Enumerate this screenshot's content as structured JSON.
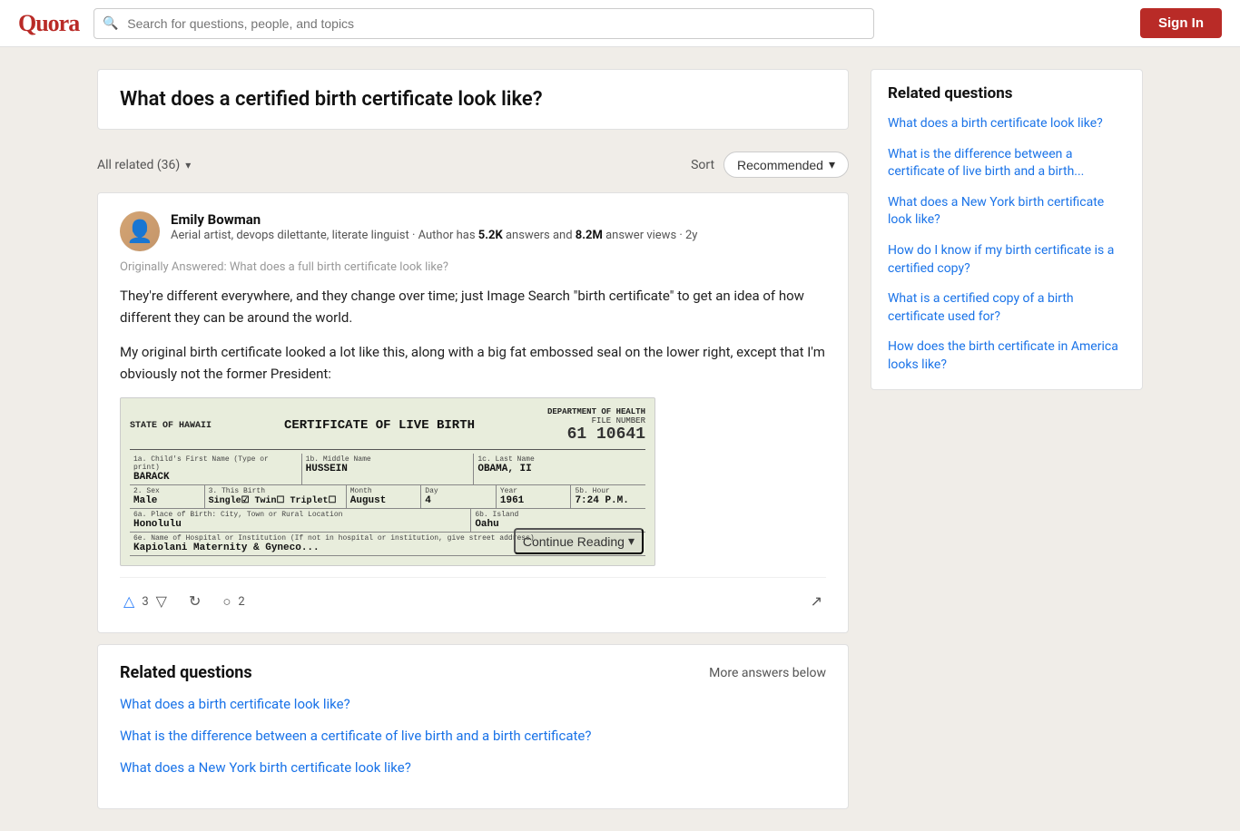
{
  "header": {
    "logo": "Quora",
    "search_placeholder": "Search for questions, people, and topics",
    "sign_in_label": "Sign In"
  },
  "question": {
    "title": "What does a certified birth certificate look like?"
  },
  "filter": {
    "all_related_label": "All related (36)",
    "sort_label": "Sort",
    "recommended_label": "Recommended"
  },
  "answer": {
    "author_name": "Emily Bowman",
    "author_bio": "Aerial artist, devops dilettante, literate linguist · Author has",
    "author_answers": "5.2K",
    "author_bio_mid": "answers and",
    "author_views": "8.2M",
    "author_bio_end": "answer views · 2y",
    "originally_answered": "Originally Answered: What does a full birth certificate look like?",
    "text1": "They're different everywhere, and they change over time; just Image Search \"birth certificate\" to get an idea of how different they can be around the world.",
    "text2": "My original birth certificate looked a lot like this, along with a big fat embossed seal on the lower right, except that I'm obviously not the former President:",
    "continue_reading": "Continue Reading",
    "upvotes": "3",
    "comments": "2"
  },
  "cert": {
    "state": "STATE OF HAWAII",
    "title": "CERTIFICATE OF LIVE BIRTH",
    "dept": "DEPARTMENT OF HEALTH",
    "file_label": "FILE NUMBER",
    "file_number": "61 10641",
    "fields": [
      {
        "label1": "1a. Child's First Name  (Type or print)",
        "value1": "BARACK",
        "label2": "1b. Middle Name",
        "value2": "HUSSEIN",
        "label3": "1c. Last Name",
        "value3": "OBAMA, II"
      },
      {
        "label1": "2. Sex",
        "value1": "Male",
        "label2": "3. This Birth",
        "value2": "Single✓ Twin□ Triplet□",
        "label3": "Month",
        "value3": "August",
        "label4": "Day",
        "value4": "4",
        "label5": "Year",
        "value5": "1961",
        "label6": "5b. Hour",
        "value6": "7:24 P.M."
      },
      {
        "label1": "6a. Place of Birth: City, Town or Rural Location",
        "value1": "Honolulu",
        "label2": "6b. Island",
        "value2": "Oahu"
      },
      {
        "label1": "6e. Name of Hospital or Institution",
        "value1": "Kapiolani Maternity & Gyneco..."
      }
    ]
  },
  "related_inline": {
    "title": "Related questions",
    "more_label": "More answers below",
    "links": [
      "What does a birth certificate look like?",
      "What is the difference between a certificate of live birth and a birth certificate?",
      "What does a New York birth certificate look like?"
    ]
  },
  "sidebar": {
    "heading": "Related questions",
    "links": [
      "What does a birth certificate look like?",
      "What is the difference between a certificate of live birth and a birth...",
      "What does a New York birth certificate look like?",
      "How do I know if my birth certificate is a certified copy?",
      "What is a certified copy of a birth certificate used for?",
      "How does the birth certificate in America looks like?"
    ]
  }
}
